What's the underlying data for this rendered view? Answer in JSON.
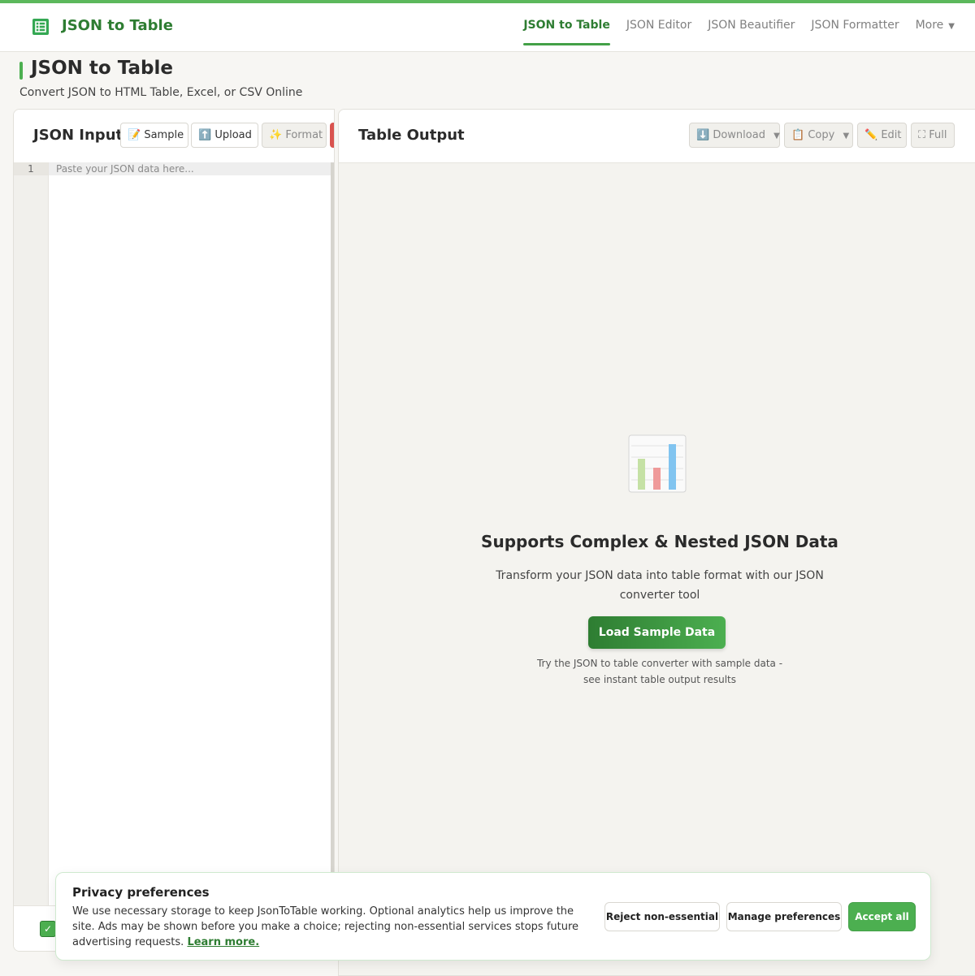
{
  "header": {
    "brand": "JSON to Table",
    "nav": [
      "JSON to Table",
      "JSON Editor",
      "JSON Beautifier",
      "JSON Formatter"
    ],
    "more": "More"
  },
  "page": {
    "title": "JSON to Table",
    "subtitle": "Convert JSON to HTML Table, Excel, or CSV Online"
  },
  "input_panel": {
    "title": "JSON Input",
    "buttons": {
      "sample": "Sample",
      "upload": "Upload",
      "format": "Format"
    },
    "line_number": "1",
    "placeholder": "Paste your JSON data here..."
  },
  "output_panel": {
    "title": "Table Output",
    "buttons": {
      "download": "Download",
      "copy": "Copy",
      "edit": "Edit",
      "full": "Full"
    },
    "empty_state": {
      "icon": "bar-chart-icon",
      "title": "Supports Complex & Nested JSON Data",
      "description": "Transform your JSON data into table format with our JSON converter tool",
      "button": "Load Sample Data",
      "note": "Try the JSON to table converter with sample data - see instant table output results"
    }
  },
  "cookie_banner": {
    "title": "Privacy preferences",
    "text": "We use necessary storage to keep JsonToTable working. Optional analytics help us improve the site. Ads may be shown before you make a choice; rejecting non-essential services stops future advertising requests.",
    "link": "Learn more.",
    "buttons": {
      "reject": "Reject non-essential",
      "manage": "Manage preferences",
      "accept": "Accept all"
    }
  },
  "colors": {
    "accent": "#2e7d32",
    "accent_light": "#4caf50",
    "danger": "#d9534f"
  }
}
